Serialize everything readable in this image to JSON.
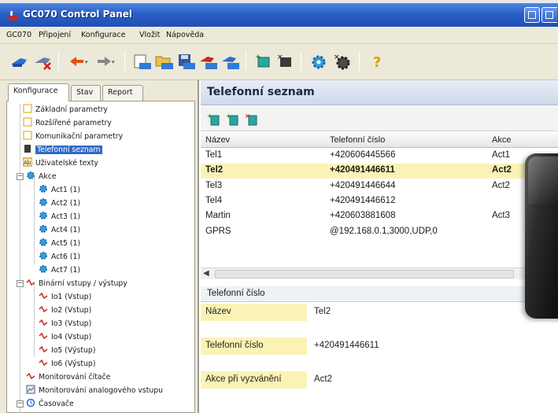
{
  "window": {
    "title": "GC070 Control Panel"
  },
  "menu": [
    "GC070",
    "Připojení",
    "Konfigurace",
    "Vložit",
    "Nápověda"
  ],
  "toolbar": [
    "connect-icon",
    "disconnect-icon",
    "back-arrow-icon",
    "forward-arrow-icon",
    "cfg-open-icon",
    "cfg-folder-icon",
    "cfg-save-icon",
    "cfg-read-icon",
    "cfg-write-icon",
    "add-module-icon",
    "remove-module-icon",
    "settings-gear-icon",
    "remove-gear-icon",
    "help-icon"
  ],
  "left": {
    "tabs": [
      "Konfigurace",
      "Stav",
      "Report"
    ],
    "tree": [
      {
        "label": "Základní parametry",
        "icon": "page-icon"
      },
      {
        "label": "Rozšířené parametry",
        "icon": "page-icon"
      },
      {
        "label": "Komunikační parametry",
        "icon": "page-icon"
      },
      {
        "label": "Telefonní seznam",
        "icon": "phone-book-icon",
        "selected": true
      },
      {
        "label": "Uživatelské texty",
        "icon": "text-icon"
      },
      {
        "label": "Akce",
        "icon": "gear-icon"
      },
      {
        "label": "Act1 (1)",
        "icon": "gear-icon"
      },
      {
        "label": "Act2 (1)",
        "icon": "gear-icon"
      },
      {
        "label": "Act3 (1)",
        "icon": "gear-icon"
      },
      {
        "label": "Act4 (1)",
        "icon": "gear-icon"
      },
      {
        "label": "Act5 (1)",
        "icon": "gear-icon"
      },
      {
        "label": "Act6 (1)",
        "icon": "gear-icon"
      },
      {
        "label": "Act7 (1)",
        "icon": "gear-icon"
      },
      {
        "label": "Binární vstupy / výstupy",
        "icon": "io-icon"
      },
      {
        "label": "Io1 (Vstup)",
        "icon": "io-icon"
      },
      {
        "label": "Io2 (Vstup)",
        "icon": "io-icon"
      },
      {
        "label": "Io3 (Vstup)",
        "icon": "io-icon"
      },
      {
        "label": "Io4 (Vstup)",
        "icon": "io-icon"
      },
      {
        "label": "Io5 (Výstup)",
        "icon": "io-icon"
      },
      {
        "label": "Io6 (Výstup)",
        "icon": "io-icon"
      },
      {
        "label": "Monitorování čítače",
        "icon": "io-icon"
      },
      {
        "label": "Monitorování analogového vstupu",
        "icon": "analog-icon"
      },
      {
        "label": "Časovače",
        "icon": "timer-icon"
      }
    ]
  },
  "right": {
    "heading": "Telefonní seznam",
    "columns": [
      "Název",
      "Telefonní číslo",
      "Akce"
    ],
    "rows": [
      {
        "name": "Tel1",
        "number": "+420606445566",
        "action": "Act1"
      },
      {
        "name": "Tel2",
        "number": "+420491446611",
        "action": "Act2",
        "highlighted": true
      },
      {
        "name": "Tel3",
        "number": "+420491446644",
        "action": "Act2"
      },
      {
        "name": "Tel4",
        "number": "+420491446612",
        "action": ""
      },
      {
        "name": "Martin",
        "number": "+420603881608",
        "action": "Act3"
      },
      {
        "name": "GPRS",
        "number": "@192.168.0.1,3000,UDP,0",
        "action": ""
      }
    ],
    "detail": {
      "title": "Telefonní číslo",
      "fields": [
        {
          "label": "Název",
          "value": "Tel2"
        },
        {
          "label": "Telefonní číslo",
          "value": "+420491446611"
        },
        {
          "label": "Akce při vyzvánění",
          "value": "Act2"
        }
      ]
    }
  }
}
